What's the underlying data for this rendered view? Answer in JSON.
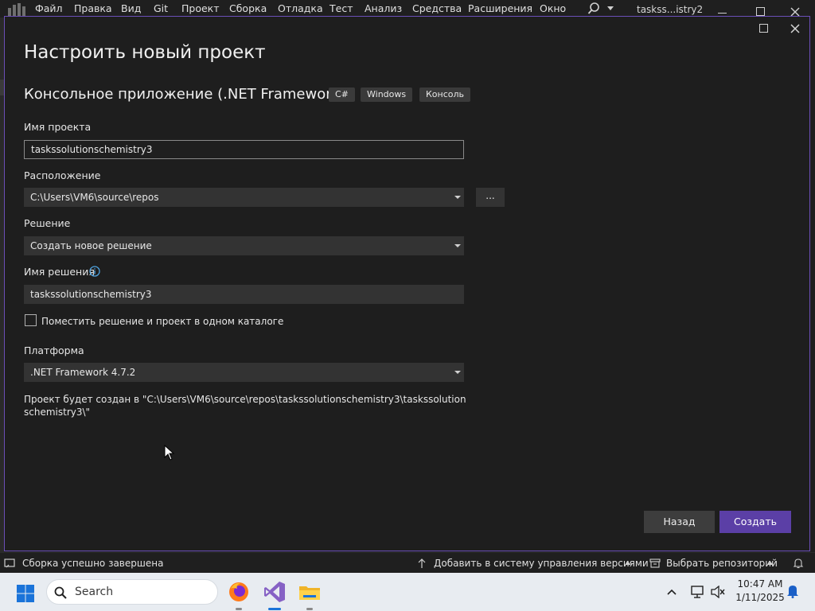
{
  "vs_menu": {
    "items": [
      "Файл",
      "Правка",
      "Вид",
      "Git",
      "Проект",
      "Сборка",
      "Отладка",
      "Тест",
      "Анализ",
      "Средства",
      "Расширения",
      "Окно"
    ],
    "window_title": "taskss...istry2"
  },
  "dialog": {
    "page_title": "Настроить новый проект",
    "template_name": "Консольное приложение (.NET Framework)",
    "tags": [
      "C#",
      "Windows",
      "Консоль"
    ],
    "project_name_label": "Имя проекта",
    "project_name_value": "taskssolutionschemistry3",
    "location_label": "Расположение",
    "location_value": "C:\\Users\\VM6\\source\\repos",
    "browse_label": "...",
    "solution_label": "Решение",
    "solution_value": "Создать новое решение",
    "solution_name_label": "Имя решения",
    "solution_name_value": "taskssolutionschemistry3",
    "same_dir_checkbox_label": "Поместить решение и проект в одном каталоге",
    "same_dir_checked": false,
    "platform_label": "Платформа",
    "platform_value": ".NET Framework 4.7.2",
    "path_note": "Проект будет создан в \"C:\\Users\\VM6\\source\\repos\\taskssolutionschemistry3\\taskssolutionschemistry3\\\"",
    "back_button": "Назад",
    "create_button": "Создать"
  },
  "statusbar": {
    "build_status": "Сборка успешно завершена",
    "source_control": "Добавить в систему управления версиями",
    "repository": "Выбрать репозиторий"
  },
  "taskbar": {
    "search_label": "Search",
    "time": "10:47 AM",
    "date": "1/11/2025"
  },
  "colors": {
    "accent": "#5b3fa6",
    "dialog_border": "#6b4fb8",
    "background": "#1e1e1e"
  },
  "icons": [
    "visual-studio-logo-icon",
    "search-icon",
    "info-icon",
    "windows-start-icon",
    "firefox-icon",
    "visual-studio-icon",
    "file-explorer-icon",
    "network-icon",
    "volume-icon",
    "notification-bell-icon"
  ]
}
